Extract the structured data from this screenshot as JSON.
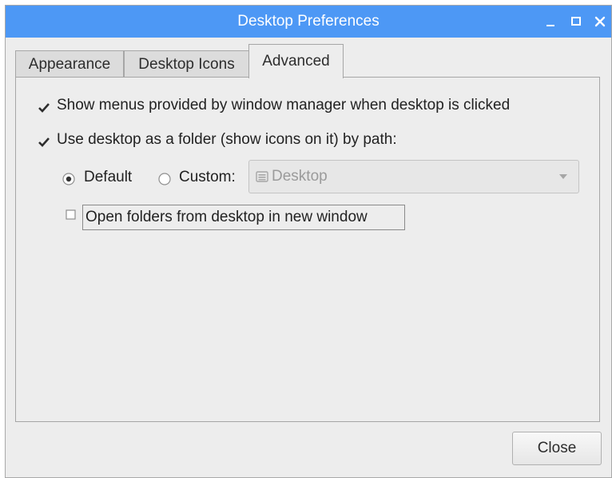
{
  "window": {
    "title": "Desktop Preferences",
    "controls": [
      "minimize",
      "maximize",
      "close"
    ]
  },
  "tabs": [
    {
      "label": "Appearance",
      "active": false
    },
    {
      "label": "Desktop Icons",
      "active": false
    },
    {
      "label": "Advanced",
      "active": true
    }
  ],
  "options": {
    "show_menus": {
      "label": "Show menus provided by window manager when desktop is clicked",
      "checked": true
    },
    "use_folder": {
      "label": "Use desktop as a folder (show icons on it) by path:",
      "checked": true
    },
    "path_default": {
      "label": "Default",
      "selected": true
    },
    "path_custom": {
      "label": "Custom:",
      "selected": false
    },
    "path_combo": {
      "value": "Desktop",
      "icon": "folder-icon",
      "disabled": true
    },
    "open_new_window": {
      "label": "Open folders from desktop in new window",
      "checked": false
    }
  },
  "buttons": {
    "close_label": "Close"
  },
  "colors": {
    "titlebar": "#4d98f5",
    "window_bg": "#ededed",
    "disabled_text": "#9b9b9b"
  }
}
